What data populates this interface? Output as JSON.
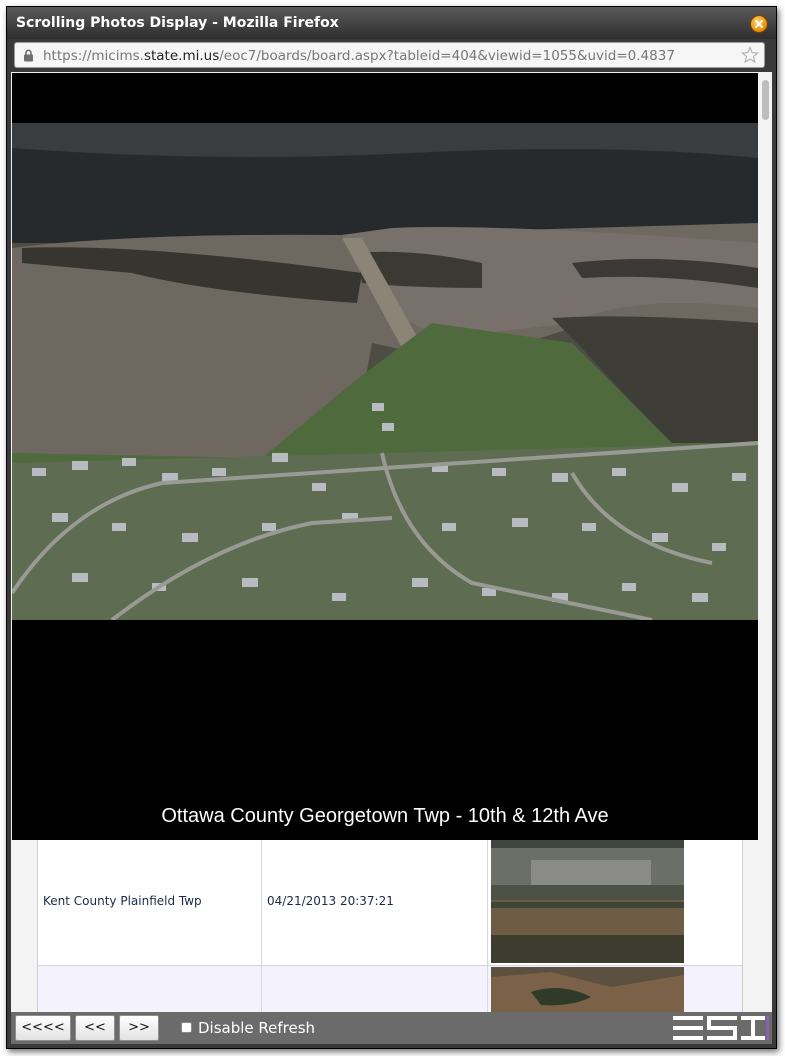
{
  "window": {
    "title": "Scrolling Photos Display - Mozilla Firefox"
  },
  "urlbar": {
    "url_prefix": "https://micims.",
    "url_domain": "state.mi.us",
    "url_path": "/eoc7/boards/board.aspx?tableid=404&viewid=1055&uvid=0.4837"
  },
  "viewer": {
    "caption": "Ottawa County Georgetown Twp - 10th & 12th Ave"
  },
  "table": {
    "rows": [
      {
        "location": "Kent County Plainfield Twp",
        "timestamp": "04/21/2013 20:37:21"
      },
      {
        "location": "",
        "timestamp": ""
      }
    ]
  },
  "toolbar": {
    "first_label": "<<<<",
    "prev_label": "<<",
    "next_label": ">>",
    "disable_refresh_label": "Disable Refresh",
    "disable_refresh_checked": false
  },
  "icons": {
    "lock": "lock-icon",
    "bookmark": "star-icon",
    "close": "close-icon",
    "logo": "esi-logo"
  }
}
